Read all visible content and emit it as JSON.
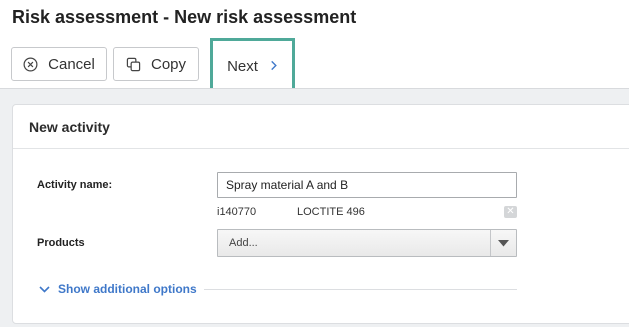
{
  "page": {
    "title": "Risk assessment - New risk assessment"
  },
  "toolbar": {
    "cancel_label": "Cancel",
    "copy_label": "Copy",
    "next_label": "Next",
    "highlight_color": "#4fa999"
  },
  "panel": {
    "title": "New activity",
    "activity_name_label": "Activity name:",
    "activity_name_value": "Spray material A and B",
    "products_label": "Products",
    "products": [
      {
        "code": "i140770",
        "name": "LOCTITE 496"
      }
    ],
    "products_select_text": "Add...",
    "show_more_label": "Show additional options",
    "link_color": "#3f78c9"
  },
  "icons": {
    "cancel": "close-circle-icon",
    "copy": "copy-icon",
    "next": "chevron-right-icon",
    "remove": "close-icon",
    "select": "caret-down-icon",
    "show_more": "chevron-down-icon"
  }
}
